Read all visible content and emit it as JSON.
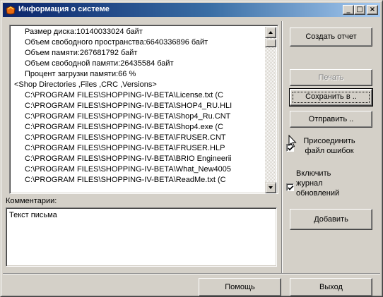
{
  "window": {
    "title": "Информация о системе",
    "controls": {
      "minimize": "_",
      "maximize": "□",
      "close": "×"
    }
  },
  "info_list": {
    "lines": [
      {
        "text": "Размер диска:10140033024 байт",
        "indent": true
      },
      {
        "text": "Объем свободного пространства:6640336896 байт",
        "indent": true
      },
      {
        "text": "Объем памяти:267681792 байт",
        "indent": true
      },
      {
        "text": "Объем свободной памяти:26435584 байт",
        "indent": true
      },
      {
        "text": "Процент загрузки памяти:66 %",
        "indent": true
      },
      {
        "text": "<Shop Directories ,Files ,CRC ,Versions>",
        "indent": false
      },
      {
        "text": "C:\\PROGRAM FILES\\SHOPPING-IV-BETA\\License.txt    (C",
        "indent": true
      },
      {
        "text": "C:\\PROGRAM FILES\\SHOPPING-IV-BETA\\SHOP4_RU.HLI",
        "indent": true
      },
      {
        "text": "C:\\PROGRAM FILES\\SHOPPING-IV-BETA\\Shop4_Ru.CNT",
        "indent": true
      },
      {
        "text": "C:\\PROGRAM FILES\\SHOPPING-IV-BETA\\Shop4.exe    (C",
        "indent": true
      },
      {
        "text": "C:\\PROGRAM FILES\\SHOPPING-IV-BETA\\FRUSER.CNT",
        "indent": true
      },
      {
        "text": "C:\\PROGRAM FILES\\SHOPPING-IV-BETA\\FRUSER.HLP",
        "indent": true
      },
      {
        "text": "C:\\PROGRAM FILES\\SHOPPING-IV-BETA\\BRIO Engineerii",
        "indent": true
      },
      {
        "text": "C:\\PROGRAM FILES\\SHOPPING-IV-BETA\\What_New4005",
        "indent": true
      },
      {
        "text": "C:\\PROGRAM FILES\\SHOPPING-IV-BETA\\ReadMe.txt    (C",
        "indent": true
      }
    ]
  },
  "comments": {
    "label": "Комментарии:",
    "value": "Текст письма"
  },
  "buttons": {
    "create_report": "Создать отчет",
    "print": "Печать",
    "save": "Сохранить в ..",
    "send": "Отправить ..",
    "add": "Добавить",
    "help": "Помощь",
    "exit": "Выход"
  },
  "checkboxes": {
    "attach_errors": {
      "label": "Присоединить файл ошибок",
      "checked": true
    },
    "include_updates": {
      "label": "Включить журнал обновлений",
      "checked": true
    }
  },
  "colors": {
    "title_gradient_start": "#0a246a",
    "title_gradient_end": "#a6caf0",
    "face": "#d4d0c8"
  }
}
